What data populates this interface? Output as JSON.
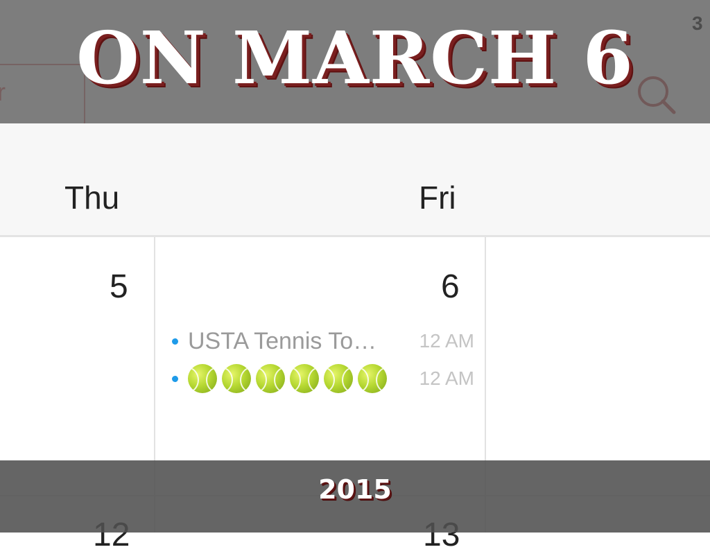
{
  "status_bar": {
    "partial_text": "3"
  },
  "toolbar": {
    "partial_button_text": "r"
  },
  "calendar": {
    "day_headers": [
      "Thu",
      "Fri"
    ],
    "dates": [
      "5",
      "6"
    ],
    "lower_dates": [
      "12",
      "13"
    ],
    "events": [
      {
        "title": "USTA Tennis To…",
        "time": "12 AM"
      },
      {
        "title": "🎾🎾🎾🎾🎾🎾",
        "time": "12 AM"
      }
    ]
  },
  "overlay": {
    "headline": "ON MARCH 6",
    "year": "2015"
  },
  "colors": {
    "headline_shadow": "#7a1f1f",
    "event_dot": "#1e9be9",
    "toolbar_button_border": "#e08a8a"
  }
}
